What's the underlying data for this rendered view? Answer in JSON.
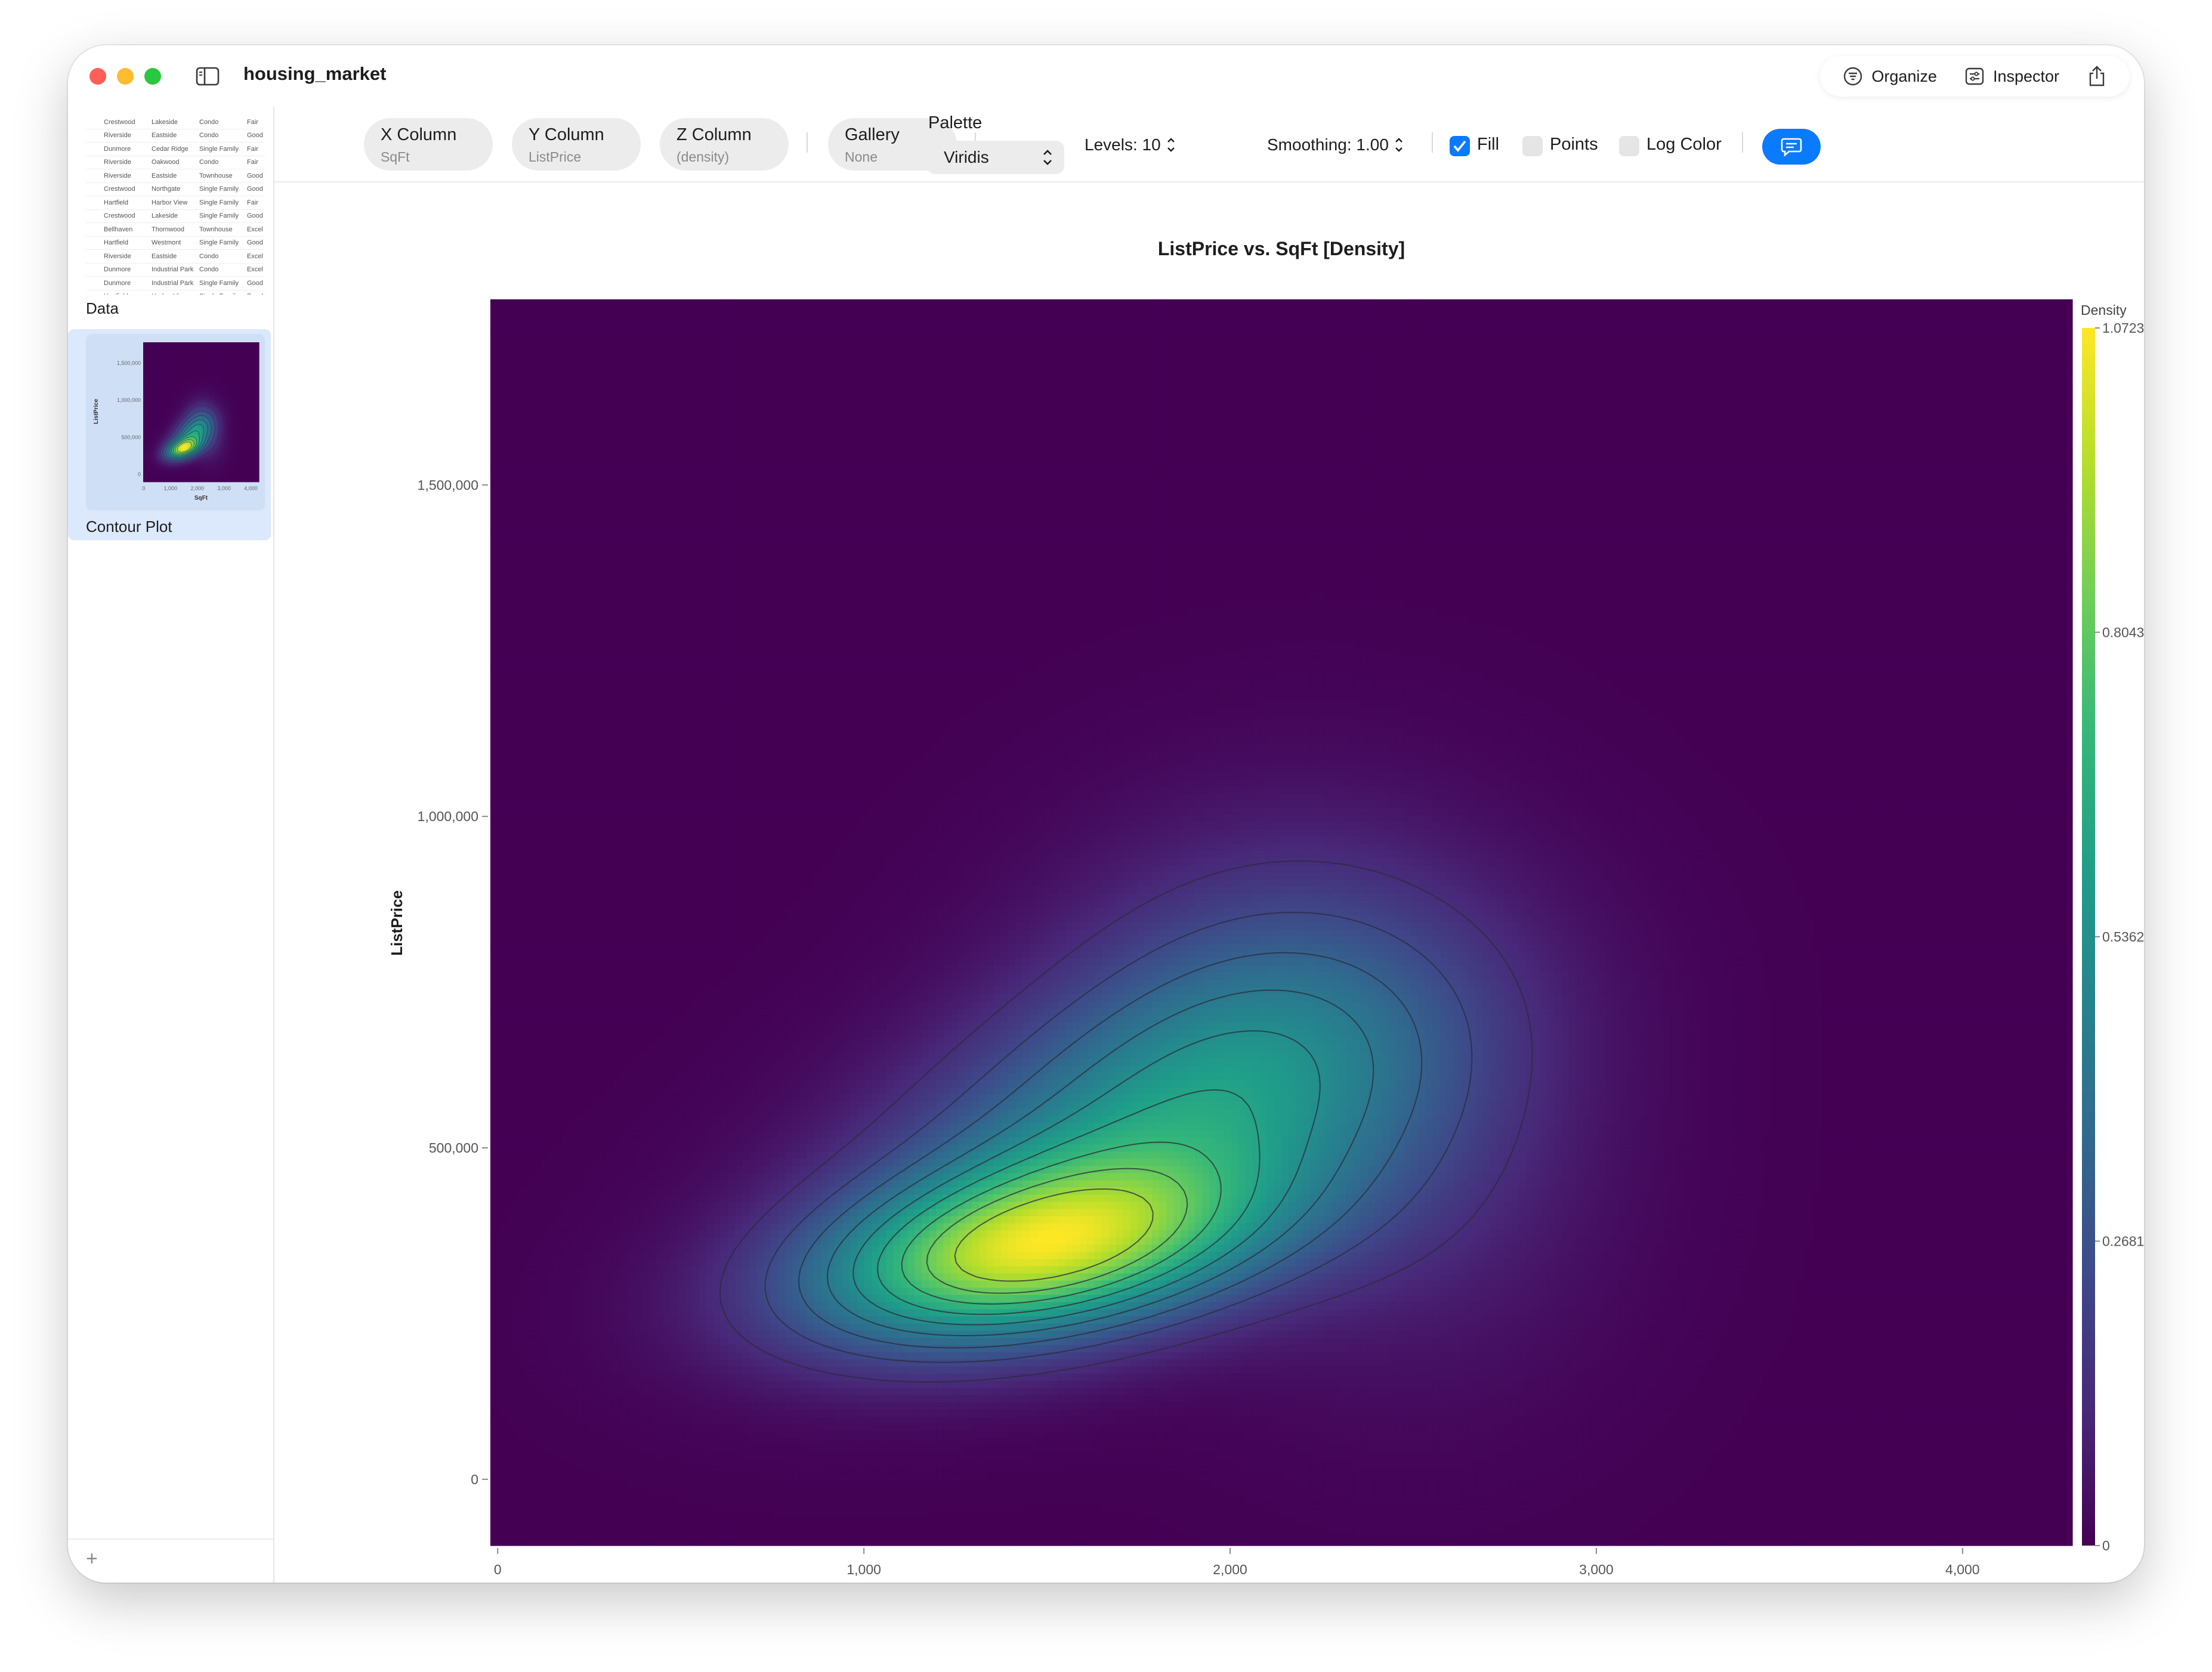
{
  "window": {
    "title": "housing_market"
  },
  "titlebar": {
    "organize_label": "Organize",
    "inspector_label": "Inspector"
  },
  "sidebar": {
    "data_label": "Data",
    "contour_label": "Contour Plot",
    "data_rows": [
      [
        "Crestwood",
        "Lakeside",
        "Condo",
        "Fair"
      ],
      [
        "Riverside",
        "Eastside",
        "Condo",
        "Good"
      ],
      [
        "Dunmore",
        "Cedar Ridge",
        "Single Family",
        "Fair"
      ],
      [
        "Riverside",
        "Oakwood",
        "Condo",
        "Fair"
      ],
      [
        "Riverside",
        "Eastside",
        "Townhouse",
        "Good"
      ],
      [
        "Crestwood",
        "Northgate",
        "Single Family",
        "Good"
      ],
      [
        "Hartfield",
        "Harbor View",
        "Single Family",
        "Fair"
      ],
      [
        "Crestwood",
        "Lakeside",
        "Single Family",
        "Good"
      ],
      [
        "Bellhaven",
        "Thornwood",
        "Townhouse",
        "Excel"
      ],
      [
        "Hartfield",
        "Westmont",
        "Single Family",
        "Good"
      ],
      [
        "Riverside",
        "Eastside",
        "Condo",
        "Excel"
      ],
      [
        "Dunmore",
        "Industrial Park",
        "Condo",
        "Excel"
      ],
      [
        "Dunmore",
        "Industrial Park",
        "Single Family",
        "Good"
      ],
      [
        "Hartfield",
        "Harbor View",
        "Single Family",
        "Excel"
      ]
    ],
    "thumb": {
      "yticks": [
        "1,500,000",
        "1,000,000",
        "500,000",
        "0"
      ],
      "xticks": [
        "0",
        "1,000",
        "2,000",
        "3,000",
        "4,000"
      ],
      "xlabel": "SqFt",
      "ylabel": "ListPrice"
    }
  },
  "toolbar": {
    "x_column": {
      "label": "X Column",
      "value": "SqFt"
    },
    "y_column": {
      "label": "Y Column",
      "value": "ListPrice"
    },
    "z_column": {
      "label": "Z Column",
      "value": "(density)"
    },
    "gallery": {
      "label": "Gallery",
      "value": "None"
    },
    "palette_label": "Palette",
    "palette_value": "Viridis",
    "levels": "Levels: 10",
    "smoothing": "Smoothing: 1.00",
    "fill_label": "Fill",
    "fill_checked": true,
    "points_label": "Points",
    "points_checked": false,
    "logcolor_label": "Log Color",
    "logcolor_checked": false
  },
  "chart_data": {
    "type": "heatmap",
    "subtype": "density contour",
    "title": "ListPrice vs. SqFt [Density]",
    "xlabel": "SqFt",
    "ylabel": "ListPrice",
    "xlim": [
      -20,
      4300
    ],
    "ylim": [
      -100000,
      1780000
    ],
    "xticks": [
      0,
      1000,
      2000,
      3000,
      4000
    ],
    "xtick_labels": [
      "0",
      "1,000",
      "2,000",
      "3,000",
      "4,000"
    ],
    "yticks": [
      0,
      500000,
      1000000,
      1500000
    ],
    "ytick_labels": [
      "0",
      "500,000",
      "1,000,000",
      "1,500,000"
    ],
    "palette": "Viridis",
    "levels": 10,
    "colorbar": {
      "title": "Density",
      "min": 0,
      "max": 1.0723,
      "ticks": [
        0,
        0.2681,
        0.5362,
        0.8043,
        1.0723
      ],
      "tick_labels": [
        "0",
        "0.2681",
        "0.5362",
        "0.8043",
        "1.0723"
      ]
    },
    "density_components": [
      {
        "weight": 1.0,
        "mx": 1450,
        "my": 340000,
        "sx": 420,
        "sy": 95000,
        "rho": 0.35
      },
      {
        "weight": 0.55,
        "mx": 1750,
        "my": 520000,
        "sx": 520,
        "sy": 170000,
        "rho": 0.45
      },
      {
        "weight": 0.28,
        "mx": 2100,
        "my": 700000,
        "sx": 420,
        "sy": 200000,
        "rho": 0.1
      },
      {
        "weight": 0.12,
        "mx": 2500,
        "my": 450000,
        "sx": 380,
        "sy": 220000,
        "rho": 0.0
      }
    ],
    "colors": {
      "viridis": [
        "#440154",
        "#482878",
        "#3e4989",
        "#31688e",
        "#26828e",
        "#1f9e89",
        "#35b779",
        "#6ece58",
        "#b5de2b",
        "#fde725"
      ],
      "contour_line": "#2b2b3a",
      "axis": "#8a8a8a"
    }
  }
}
